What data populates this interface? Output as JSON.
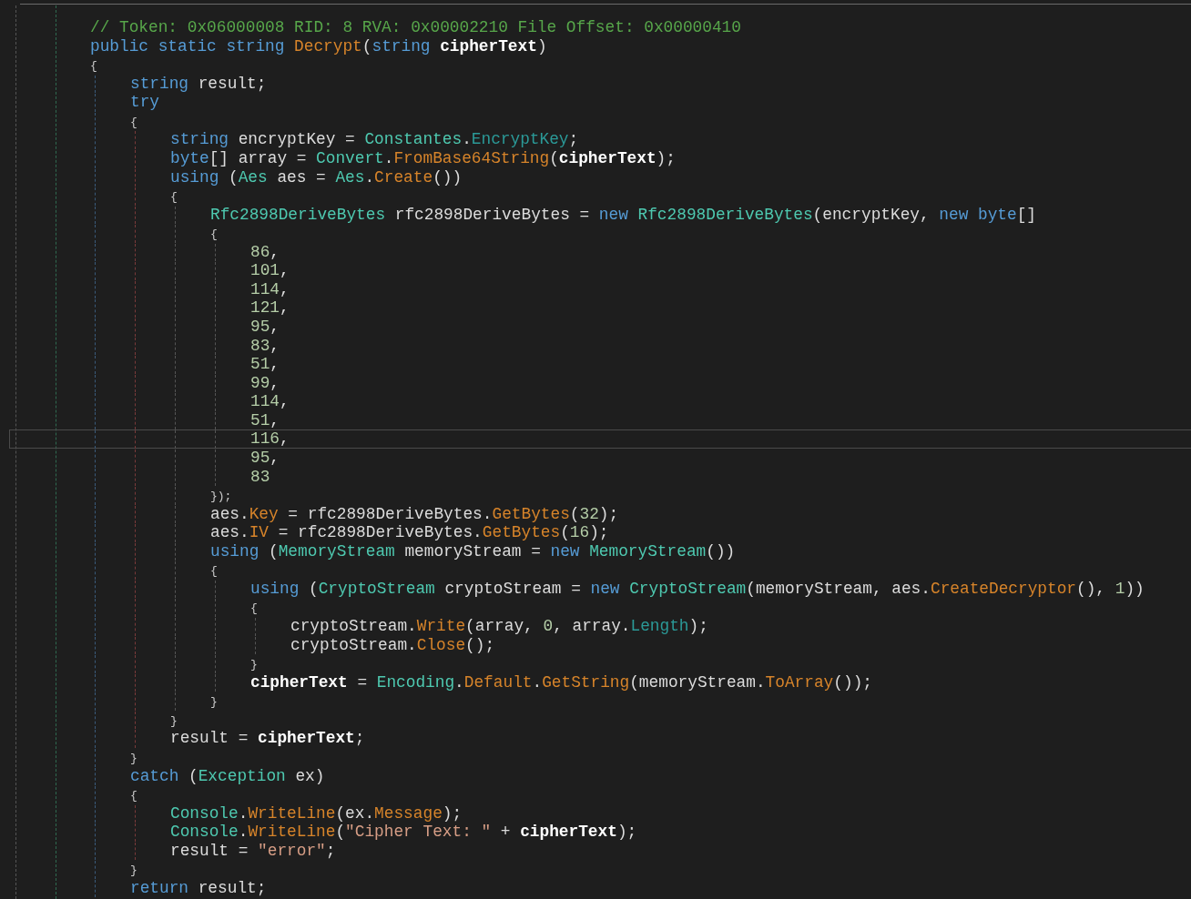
{
  "editor": {
    "lines": [
      {
        "current": false,
        "tokens": [
          {
            "kind": "comment",
            "text": "// Token: 0x06000008 RID: 8 RVA: 0x00002210 File Offset: 0x00000410"
          }
        ]
      },
      {
        "current": false,
        "tokens": [
          {
            "kind": "keyword",
            "text": "public static string "
          },
          {
            "kind": "member",
            "text": "Decrypt"
          },
          {
            "kind": "plain",
            "text": "("
          },
          {
            "kind": "keyword",
            "text": "string "
          },
          {
            "kind": "param",
            "text": "cipherText"
          },
          {
            "kind": "plain",
            "text": ")"
          }
        ]
      },
      {
        "current": false,
        "tokens": [
          {
            "kind": "brace",
            "text": "{"
          }
        ],
        "children": [
          {
            "current": false,
            "tokens": [
              {
                "kind": "keyword",
                "text": "string"
              },
              {
                "kind": "plain",
                "text": " result;"
              }
            ]
          },
          {
            "current": false,
            "tokens": [
              {
                "kind": "keyword",
                "text": "try"
              }
            ]
          },
          {
            "current": false,
            "tokens": [
              {
                "kind": "brace",
                "text": "{"
              }
            ],
            "children": [
              {
                "current": false,
                "tokens": [
                  {
                    "kind": "keyword",
                    "text": "string"
                  },
                  {
                    "kind": "plain",
                    "text": " encryptKey = "
                  },
                  {
                    "kind": "type",
                    "text": "Constantes"
                  },
                  {
                    "kind": "plain",
                    "text": "."
                  },
                  {
                    "kind": "field",
                    "text": "EncryptKey"
                  },
                  {
                    "kind": "plain",
                    "text": ";"
                  }
                ]
              },
              {
                "current": false,
                "tokens": [
                  {
                    "kind": "keyword",
                    "text": "byte"
                  },
                  {
                    "kind": "plain",
                    "text": "[] array = "
                  },
                  {
                    "kind": "type",
                    "text": "Convert"
                  },
                  {
                    "kind": "plain",
                    "text": "."
                  },
                  {
                    "kind": "member",
                    "text": "FromBase64String"
                  },
                  {
                    "kind": "plain",
                    "text": "("
                  },
                  {
                    "kind": "param",
                    "text": "cipherText"
                  },
                  {
                    "kind": "plain",
                    "text": ");"
                  }
                ]
              },
              {
                "current": false,
                "tokens": [
                  {
                    "kind": "keyword",
                    "text": "using"
                  },
                  {
                    "kind": "plain",
                    "text": " ("
                  },
                  {
                    "kind": "type",
                    "text": "Aes"
                  },
                  {
                    "kind": "plain",
                    "text": " aes = "
                  },
                  {
                    "kind": "type",
                    "text": "Aes"
                  },
                  {
                    "kind": "plain",
                    "text": "."
                  },
                  {
                    "kind": "member",
                    "text": "Create"
                  },
                  {
                    "kind": "plain",
                    "text": "())"
                  }
                ]
              },
              {
                "current": false,
                "tokens": [
                  {
                    "kind": "brace",
                    "text": "{"
                  }
                ],
                "children": [
                  {
                    "current": false,
                    "tokens": [
                      {
                        "kind": "type",
                        "text": "Rfc2898DeriveBytes"
                      },
                      {
                        "kind": "plain",
                        "text": " rfc2898DeriveBytes = "
                      },
                      {
                        "kind": "keyword",
                        "text": "new "
                      },
                      {
                        "kind": "type",
                        "text": "Rfc2898DeriveBytes"
                      },
                      {
                        "kind": "plain",
                        "text": "(encryptKey, "
                      },
                      {
                        "kind": "keyword",
                        "text": "new byte"
                      },
                      {
                        "kind": "plain",
                        "text": "[]"
                      }
                    ]
                  },
                  {
                    "current": false,
                    "tokens": [
                      {
                        "kind": "brace",
                        "text": "{"
                      }
                    ],
                    "children": [
                      {
                        "current": false,
                        "tokens": [
                          {
                            "kind": "number",
                            "text": "86"
                          },
                          {
                            "kind": "plain",
                            "text": ","
                          }
                        ]
                      },
                      {
                        "current": false,
                        "tokens": [
                          {
                            "kind": "number",
                            "text": "101"
                          },
                          {
                            "kind": "plain",
                            "text": ","
                          }
                        ]
                      },
                      {
                        "current": false,
                        "tokens": [
                          {
                            "kind": "number",
                            "text": "114"
                          },
                          {
                            "kind": "plain",
                            "text": ","
                          }
                        ]
                      },
                      {
                        "current": false,
                        "tokens": [
                          {
                            "kind": "number",
                            "text": "121"
                          },
                          {
                            "kind": "plain",
                            "text": ","
                          }
                        ]
                      },
                      {
                        "current": false,
                        "tokens": [
                          {
                            "kind": "number",
                            "text": "95"
                          },
                          {
                            "kind": "plain",
                            "text": ","
                          }
                        ]
                      },
                      {
                        "current": false,
                        "tokens": [
                          {
                            "kind": "number",
                            "text": "83"
                          },
                          {
                            "kind": "plain",
                            "text": ","
                          }
                        ]
                      },
                      {
                        "current": false,
                        "tokens": [
                          {
                            "kind": "number",
                            "text": "51"
                          },
                          {
                            "kind": "plain",
                            "text": ","
                          }
                        ]
                      },
                      {
                        "current": false,
                        "tokens": [
                          {
                            "kind": "number",
                            "text": "99"
                          },
                          {
                            "kind": "plain",
                            "text": ","
                          }
                        ]
                      },
                      {
                        "current": false,
                        "tokens": [
                          {
                            "kind": "number",
                            "text": "114"
                          },
                          {
                            "kind": "plain",
                            "text": ","
                          }
                        ]
                      },
                      {
                        "current": false,
                        "tokens": [
                          {
                            "kind": "number",
                            "text": "51"
                          },
                          {
                            "kind": "plain",
                            "text": ","
                          }
                        ]
                      },
                      {
                        "current": true,
                        "tokens": [
                          {
                            "kind": "number",
                            "text": "116"
                          },
                          {
                            "kind": "plain",
                            "text": ","
                          }
                        ]
                      },
                      {
                        "current": false,
                        "tokens": [
                          {
                            "kind": "number",
                            "text": "95"
                          },
                          {
                            "kind": "plain",
                            "text": ","
                          }
                        ]
                      },
                      {
                        "current": false,
                        "tokens": [
                          {
                            "kind": "number",
                            "text": "83"
                          }
                        ]
                      }
                    ]
                  },
                  {
                    "current": false,
                    "tokens": [
                      {
                        "kind": "brace",
                        "text": "});"
                      }
                    ]
                  },
                  {
                    "current": false,
                    "tokens": [
                      {
                        "kind": "plain",
                        "text": "aes."
                      },
                      {
                        "kind": "member",
                        "text": "Key"
                      },
                      {
                        "kind": "plain",
                        "text": " = rfc2898DeriveBytes."
                      },
                      {
                        "kind": "member",
                        "text": "GetBytes"
                      },
                      {
                        "kind": "plain",
                        "text": "("
                      },
                      {
                        "kind": "number",
                        "text": "32"
                      },
                      {
                        "kind": "plain",
                        "text": ");"
                      }
                    ]
                  },
                  {
                    "current": false,
                    "tokens": [
                      {
                        "kind": "plain",
                        "text": "aes."
                      },
                      {
                        "kind": "member",
                        "text": "IV"
                      },
                      {
                        "kind": "plain",
                        "text": " = rfc2898DeriveBytes."
                      },
                      {
                        "kind": "member",
                        "text": "GetBytes"
                      },
                      {
                        "kind": "plain",
                        "text": "("
                      },
                      {
                        "kind": "number",
                        "text": "16"
                      },
                      {
                        "kind": "plain",
                        "text": ");"
                      }
                    ]
                  },
                  {
                    "current": false,
                    "tokens": [
                      {
                        "kind": "keyword",
                        "text": "using"
                      },
                      {
                        "kind": "plain",
                        "text": " ("
                      },
                      {
                        "kind": "type",
                        "text": "MemoryStream"
                      },
                      {
                        "kind": "plain",
                        "text": " memoryStream = "
                      },
                      {
                        "kind": "keyword",
                        "text": "new "
                      },
                      {
                        "kind": "type",
                        "text": "MemoryStream"
                      },
                      {
                        "kind": "plain",
                        "text": "())"
                      }
                    ]
                  },
                  {
                    "current": false,
                    "tokens": [
                      {
                        "kind": "brace",
                        "text": "{"
                      }
                    ],
                    "children": [
                      {
                        "current": false,
                        "tokens": [
                          {
                            "kind": "keyword",
                            "text": "using"
                          },
                          {
                            "kind": "plain",
                            "text": " ("
                          },
                          {
                            "kind": "type",
                            "text": "CryptoStream"
                          },
                          {
                            "kind": "plain",
                            "text": " cryptoStream = "
                          },
                          {
                            "kind": "keyword",
                            "text": "new "
                          },
                          {
                            "kind": "type",
                            "text": "CryptoStream"
                          },
                          {
                            "kind": "plain",
                            "text": "(memoryStream, aes."
                          },
                          {
                            "kind": "member",
                            "text": "CreateDecryptor"
                          },
                          {
                            "kind": "plain",
                            "text": "(), "
                          },
                          {
                            "kind": "number",
                            "text": "1"
                          },
                          {
                            "kind": "plain",
                            "text": "))"
                          }
                        ]
                      },
                      {
                        "current": false,
                        "tokens": [
                          {
                            "kind": "brace",
                            "text": "{"
                          }
                        ],
                        "children": [
                          {
                            "current": false,
                            "tokens": [
                              {
                                "kind": "plain",
                                "text": "cryptoStream."
                              },
                              {
                                "kind": "member",
                                "text": "Write"
                              },
                              {
                                "kind": "plain",
                                "text": "(array, "
                              },
                              {
                                "kind": "number",
                                "text": "0"
                              },
                              {
                                "kind": "plain",
                                "text": ", array."
                              },
                              {
                                "kind": "field",
                                "text": "Length"
                              },
                              {
                                "kind": "plain",
                                "text": ");"
                              }
                            ]
                          },
                          {
                            "current": false,
                            "tokens": [
                              {
                                "kind": "plain",
                                "text": "cryptoStream."
                              },
                              {
                                "kind": "member",
                                "text": "Close"
                              },
                              {
                                "kind": "plain",
                                "text": "();"
                              }
                            ]
                          }
                        ]
                      },
                      {
                        "current": false,
                        "tokens": [
                          {
                            "kind": "brace",
                            "text": "}"
                          }
                        ]
                      },
                      {
                        "current": false,
                        "tokens": [
                          {
                            "kind": "param",
                            "text": "cipherText"
                          },
                          {
                            "kind": "plain",
                            "text": " = "
                          },
                          {
                            "kind": "type",
                            "text": "Encoding"
                          },
                          {
                            "kind": "plain",
                            "text": "."
                          },
                          {
                            "kind": "member",
                            "text": "Default"
                          },
                          {
                            "kind": "plain",
                            "text": "."
                          },
                          {
                            "kind": "member",
                            "text": "GetString"
                          },
                          {
                            "kind": "plain",
                            "text": "(memoryStream."
                          },
                          {
                            "kind": "member",
                            "text": "ToArray"
                          },
                          {
                            "kind": "plain",
                            "text": "());"
                          }
                        ]
                      }
                    ]
                  },
                  {
                    "current": false,
                    "tokens": [
                      {
                        "kind": "brace",
                        "text": "}"
                      }
                    ]
                  }
                ]
              },
              {
                "current": false,
                "tokens": [
                  {
                    "kind": "brace",
                    "text": "}"
                  }
                ]
              },
              {
                "current": false,
                "tokens": [
                  {
                    "kind": "plain",
                    "text": "result = "
                  },
                  {
                    "kind": "param",
                    "text": "cipherText"
                  },
                  {
                    "kind": "plain",
                    "text": ";"
                  }
                ]
              }
            ]
          },
          {
            "current": false,
            "tokens": [
              {
                "kind": "brace",
                "text": "}"
              }
            ]
          },
          {
            "current": false,
            "tokens": [
              {
                "kind": "keyword",
                "text": "catch"
              },
              {
                "kind": "plain",
                "text": " ("
              },
              {
                "kind": "type",
                "text": "Exception"
              },
              {
                "kind": "plain",
                "text": " ex)"
              }
            ]
          },
          {
            "current": false,
            "tokens": [
              {
                "kind": "brace",
                "text": "{"
              }
            ],
            "children": [
              {
                "current": false,
                "tokens": [
                  {
                    "kind": "type",
                    "text": "Console"
                  },
                  {
                    "kind": "plain",
                    "text": "."
                  },
                  {
                    "kind": "member",
                    "text": "WriteLine"
                  },
                  {
                    "kind": "plain",
                    "text": "(ex."
                  },
                  {
                    "kind": "member",
                    "text": "Message"
                  },
                  {
                    "kind": "plain",
                    "text": ");"
                  }
                ]
              },
              {
                "current": false,
                "tokens": [
                  {
                    "kind": "type",
                    "text": "Console"
                  },
                  {
                    "kind": "plain",
                    "text": "."
                  },
                  {
                    "kind": "member",
                    "text": "WriteLine"
                  },
                  {
                    "kind": "plain",
                    "text": "("
                  },
                  {
                    "kind": "string",
                    "text": "\"Cipher Text: \""
                  },
                  {
                    "kind": "plain",
                    "text": " + "
                  },
                  {
                    "kind": "param",
                    "text": "cipherText"
                  },
                  {
                    "kind": "plain",
                    "text": ");"
                  }
                ]
              },
              {
                "current": false,
                "tokens": [
                  {
                    "kind": "plain",
                    "text": "result = "
                  },
                  {
                    "kind": "string",
                    "text": "\"error\""
                  },
                  {
                    "kind": "plain",
                    "text": ";"
                  }
                ]
              }
            ]
          },
          {
            "current": false,
            "tokens": [
              {
                "kind": "brace",
                "text": "}"
              }
            ]
          },
          {
            "current": false,
            "tokens": [
              {
                "kind": "keyword",
                "text": "return"
              },
              {
                "kind": "plain",
                "text": " result;"
              }
            ]
          }
        ]
      }
    ]
  }
}
